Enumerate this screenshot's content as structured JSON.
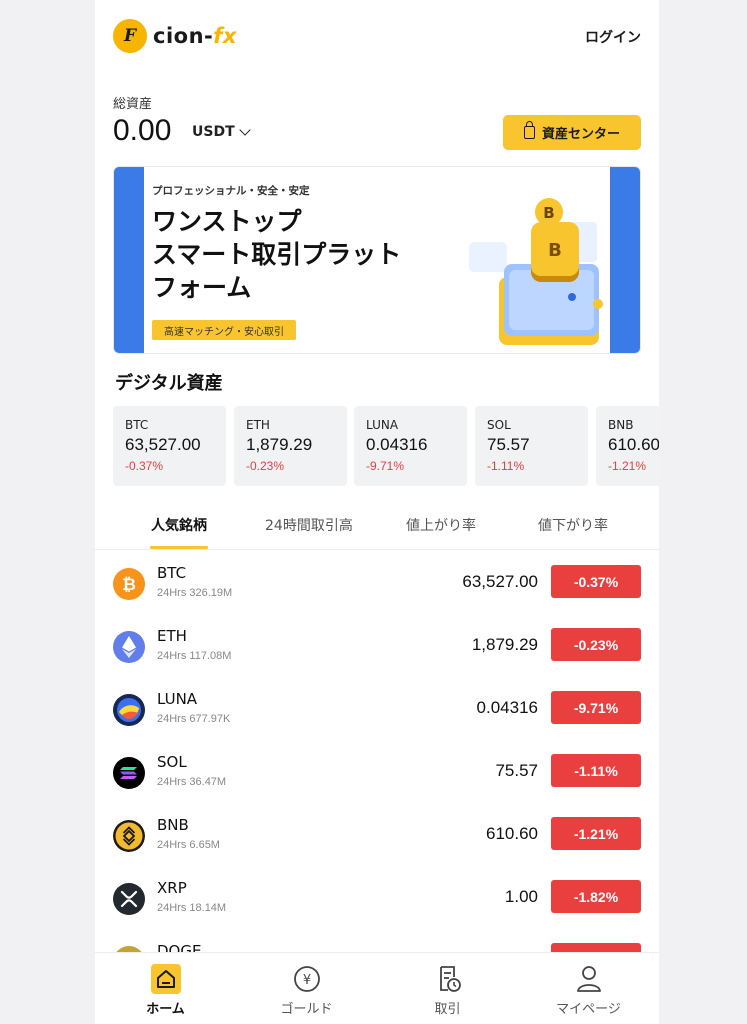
{
  "header": {
    "logo_text_main": "cion-",
    "logo_text_accent": "fx",
    "logo_mark": "F",
    "login_label": "ログイン"
  },
  "assets": {
    "label": "総資産",
    "value": "0.00",
    "unit": "USDT",
    "center_button": "資産センター"
  },
  "banner": {
    "subtitle": "プロフェッショナル・安全・安定",
    "title_line1": "ワンストップ",
    "title_line2": "スマート取引プラット",
    "title_line3": "フォーム",
    "tag": "高速マッチング・安心取引",
    "coin_letter": "B"
  },
  "digital_assets": {
    "title": "デジタル資産",
    "cards": [
      {
        "symbol": "BTC",
        "price": "63,527.00",
        "change": "-0.37%"
      },
      {
        "symbol": "ETH",
        "price": "1,879.29",
        "change": "-0.23%"
      },
      {
        "symbol": "LUNA",
        "price": "0.04316",
        "change": "-9.71%"
      },
      {
        "symbol": "SOL",
        "price": "75.57",
        "change": "-1.11%"
      },
      {
        "symbol": "BNB",
        "price": "610.60",
        "change": "-1.21%"
      }
    ]
  },
  "tabs": [
    "人気銘柄",
    "24時間取引高",
    "値上がり率",
    "値下がり率"
  ],
  "market": [
    {
      "name": "BTC",
      "volume": "24Hrs 326.19M",
      "price": "63,527.00",
      "change": "-0.37%",
      "icon": "bitcoin-icon"
    },
    {
      "name": "ETH",
      "volume": "24Hrs 117.08M",
      "price": "1,879.29",
      "change": "-0.23%",
      "icon": "ethereum-icon"
    },
    {
      "name": "LUNA",
      "volume": "24Hrs 677.97K",
      "price": "0.04316",
      "change": "-9.71%",
      "icon": "luna-icon"
    },
    {
      "name": "SOL",
      "volume": "24Hrs 36.47M",
      "price": "75.57",
      "change": "-1.11%",
      "icon": "solana-icon"
    },
    {
      "name": "BNB",
      "volume": "24Hrs 6.65M",
      "price": "610.60",
      "change": "-1.21%",
      "icon": "bnb-icon"
    },
    {
      "name": "XRP",
      "volume": "24Hrs 18.14M",
      "price": "1.00",
      "change": "-1.82%",
      "icon": "xrp-icon"
    },
    {
      "name": "DOGE",
      "volume": "",
      "price": "",
      "change": "",
      "icon": "doge-icon"
    }
  ],
  "bottom_nav": [
    {
      "label": "ホーム",
      "icon": "home-icon",
      "active": true
    },
    {
      "label": "ゴールド",
      "icon": "yen-coin-icon",
      "active": false
    },
    {
      "label": "取引",
      "icon": "order-history-icon",
      "active": false
    },
    {
      "label": "マイページ",
      "icon": "user-icon",
      "active": false
    }
  ],
  "colors": {
    "accent": "#f8c52f",
    "negative": "#ea3f3f",
    "banner_blue": "#3b7be8"
  }
}
